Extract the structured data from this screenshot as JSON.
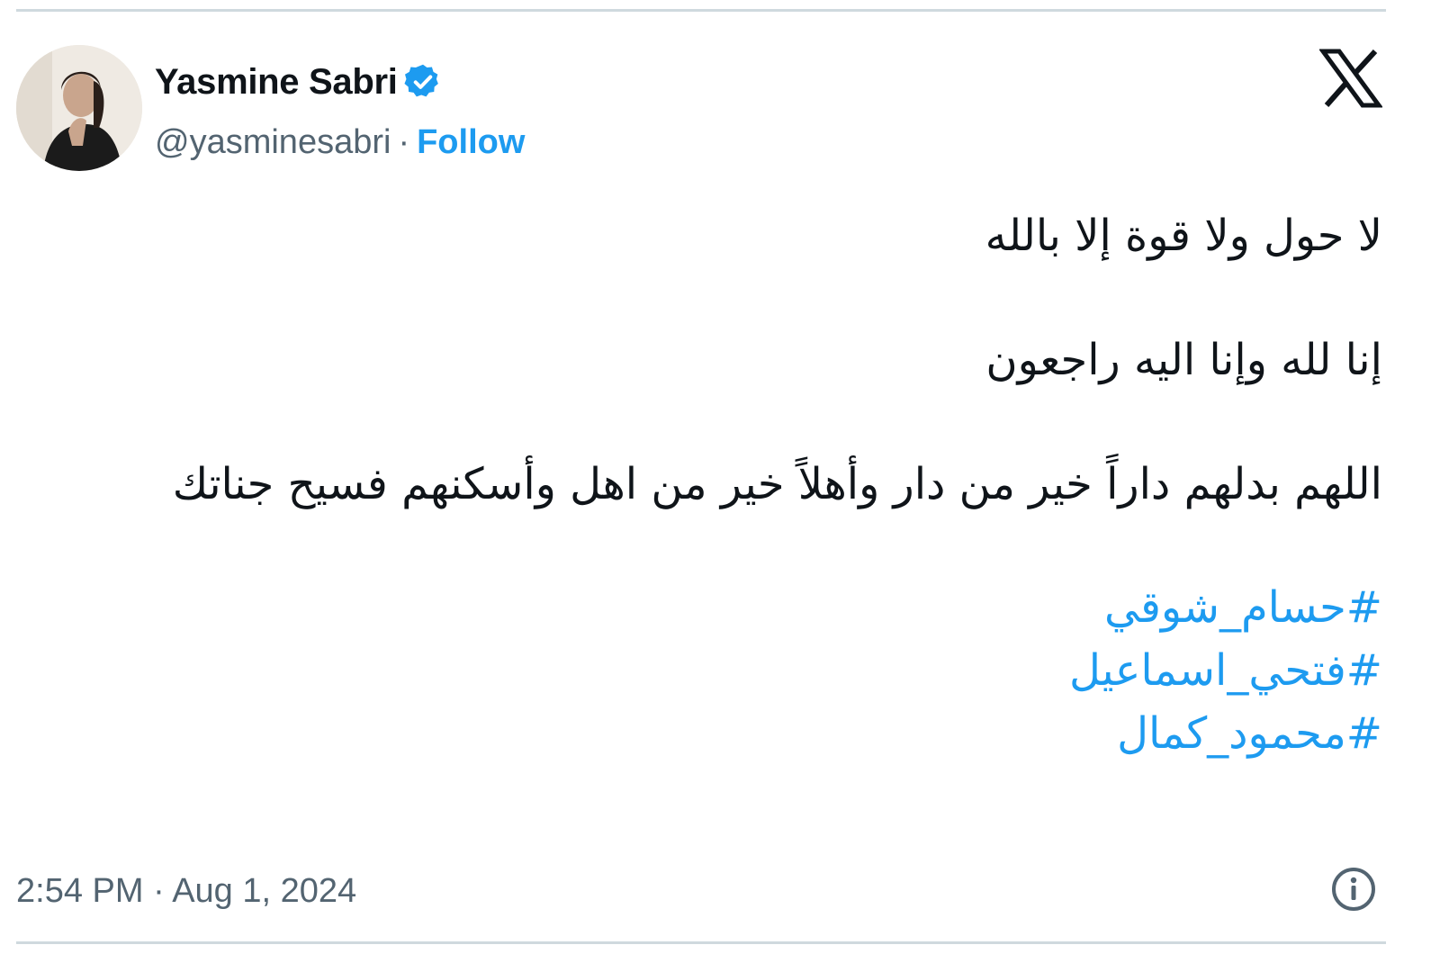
{
  "author": {
    "display_name": "Yasmine Sabri",
    "handle": "@yasminesabri",
    "separator": "·",
    "follow_label": "Follow",
    "verified_icon": "verified-badge-icon",
    "avatar_icon": "avatar"
  },
  "brand": {
    "logo_icon": "x-logo-icon",
    "accent_color": "#1d9bf0",
    "text_color": "#0f1419",
    "muted_color": "#536471"
  },
  "tweet": {
    "lines": [
      "لا حول ولا قوة إلا بالله",
      "إنا لله وإنا اليه راجعون",
      "اللهم بدلهم داراً خير من دار وأهلاً خير من اهل وأسكنهم فسيح جناتك"
    ],
    "hashtags": [
      "#حسام_شوقي",
      "#فتحي_اسماعيل",
      "#محمود_كمال"
    ]
  },
  "footer": {
    "timestamp": "2:54 PM · Aug 1, 2024",
    "info_icon": "info-icon"
  }
}
